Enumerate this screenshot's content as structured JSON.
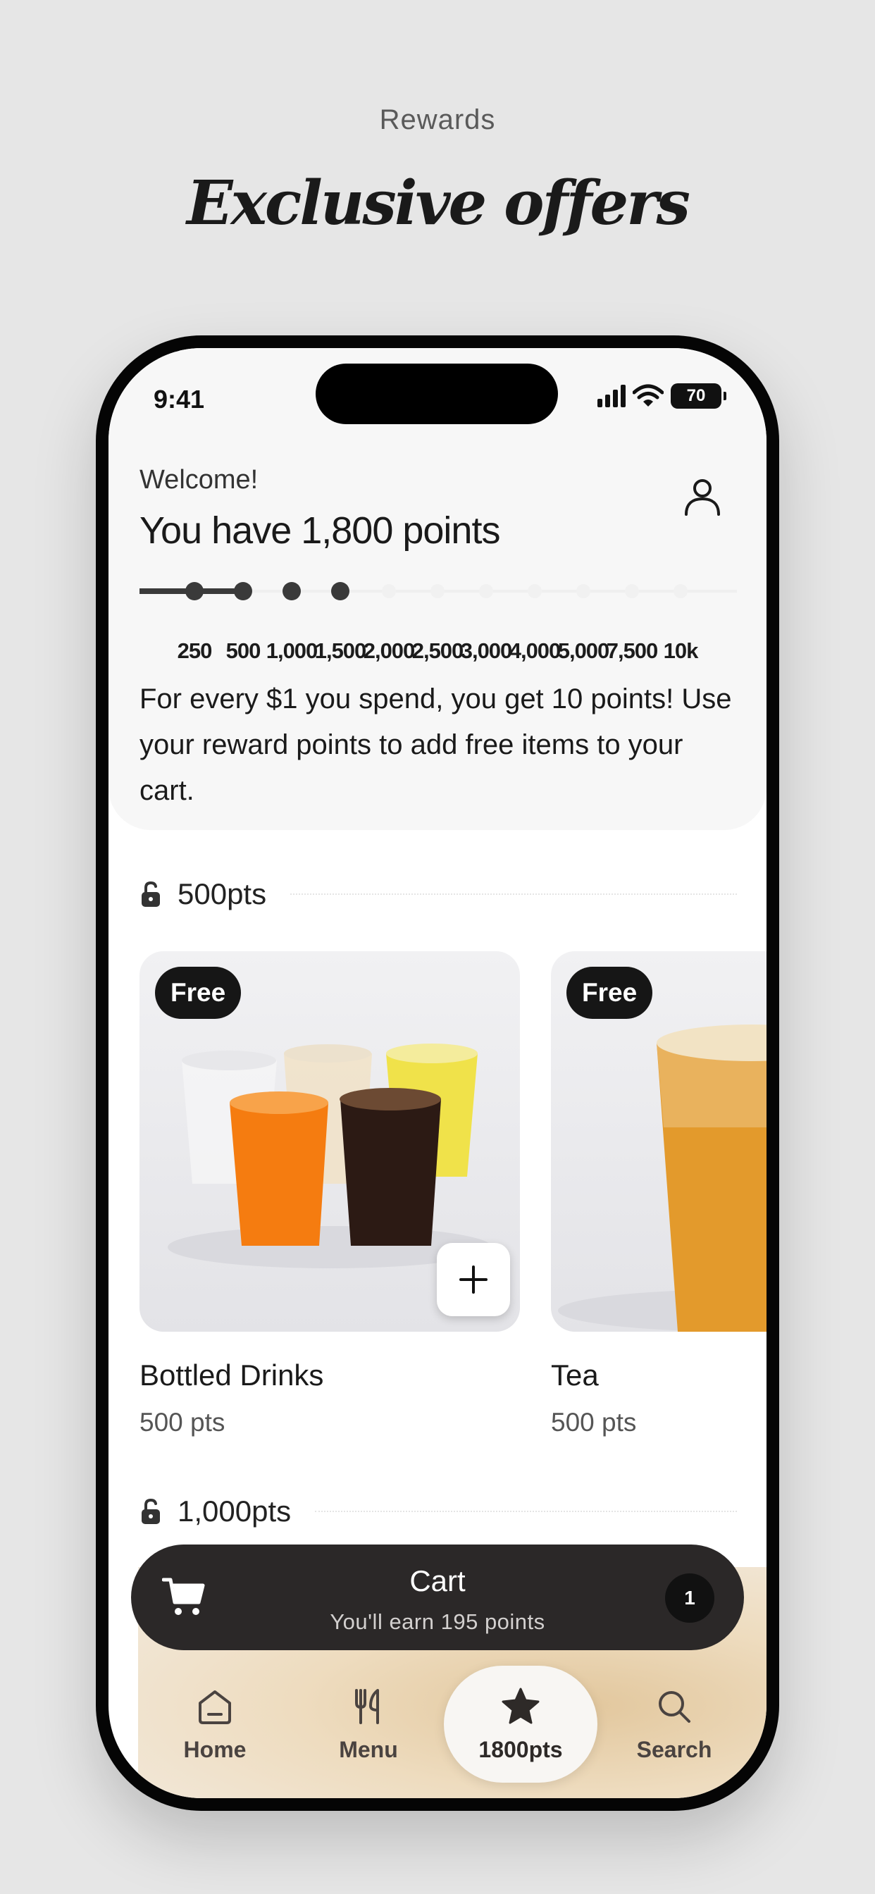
{
  "header": {
    "label": "Rewards",
    "title": "Exclusive offers"
  },
  "status_bar": {
    "time": "9:41",
    "battery": "70"
  },
  "welcome": {
    "greeting": "Welcome!",
    "points_title": "You have 1,800 points",
    "current_points": 1800,
    "tiers": [
      {
        "label": "250",
        "reached": true
      },
      {
        "label": "500",
        "reached": true
      },
      {
        "label": "1,000",
        "reached": true
      },
      {
        "label": "1,500",
        "reached": true
      },
      {
        "label": "2,000",
        "reached": false
      },
      {
        "label": "2,500",
        "reached": false
      },
      {
        "label": "3,000",
        "reached": false
      },
      {
        "label": "4,000",
        "reached": false
      },
      {
        "label": "5,000",
        "reached": false
      },
      {
        "label": "7,500",
        "reached": false
      },
      {
        "label": "10k",
        "reached": false
      }
    ],
    "rules": "For every $1 you spend, you get 10 points! Use your reward points to add free items to your cart."
  },
  "sections": [
    {
      "title": "500pts",
      "items": [
        {
          "badge": "Free",
          "name": "Bottled Drinks",
          "price": "500 pts"
        },
        {
          "badge": "Free",
          "name": "Tea",
          "price": "500 pts"
        }
      ]
    },
    {
      "title": "1,000pts",
      "items": []
    }
  ],
  "cart": {
    "title": "Cart",
    "subtitle": "You'll earn 195 points",
    "count": "1"
  },
  "tabs": [
    {
      "label": "Home",
      "icon": "home-icon"
    },
    {
      "label": "Menu",
      "icon": "utensils-icon"
    },
    {
      "label": "1800pts",
      "icon": "star-icon",
      "active": true
    },
    {
      "label": "Search",
      "icon": "search-icon"
    }
  ],
  "colors": {
    "background": "#e6e6e6",
    "dark": "#2b2828",
    "card": "#f7f7f7"
  }
}
